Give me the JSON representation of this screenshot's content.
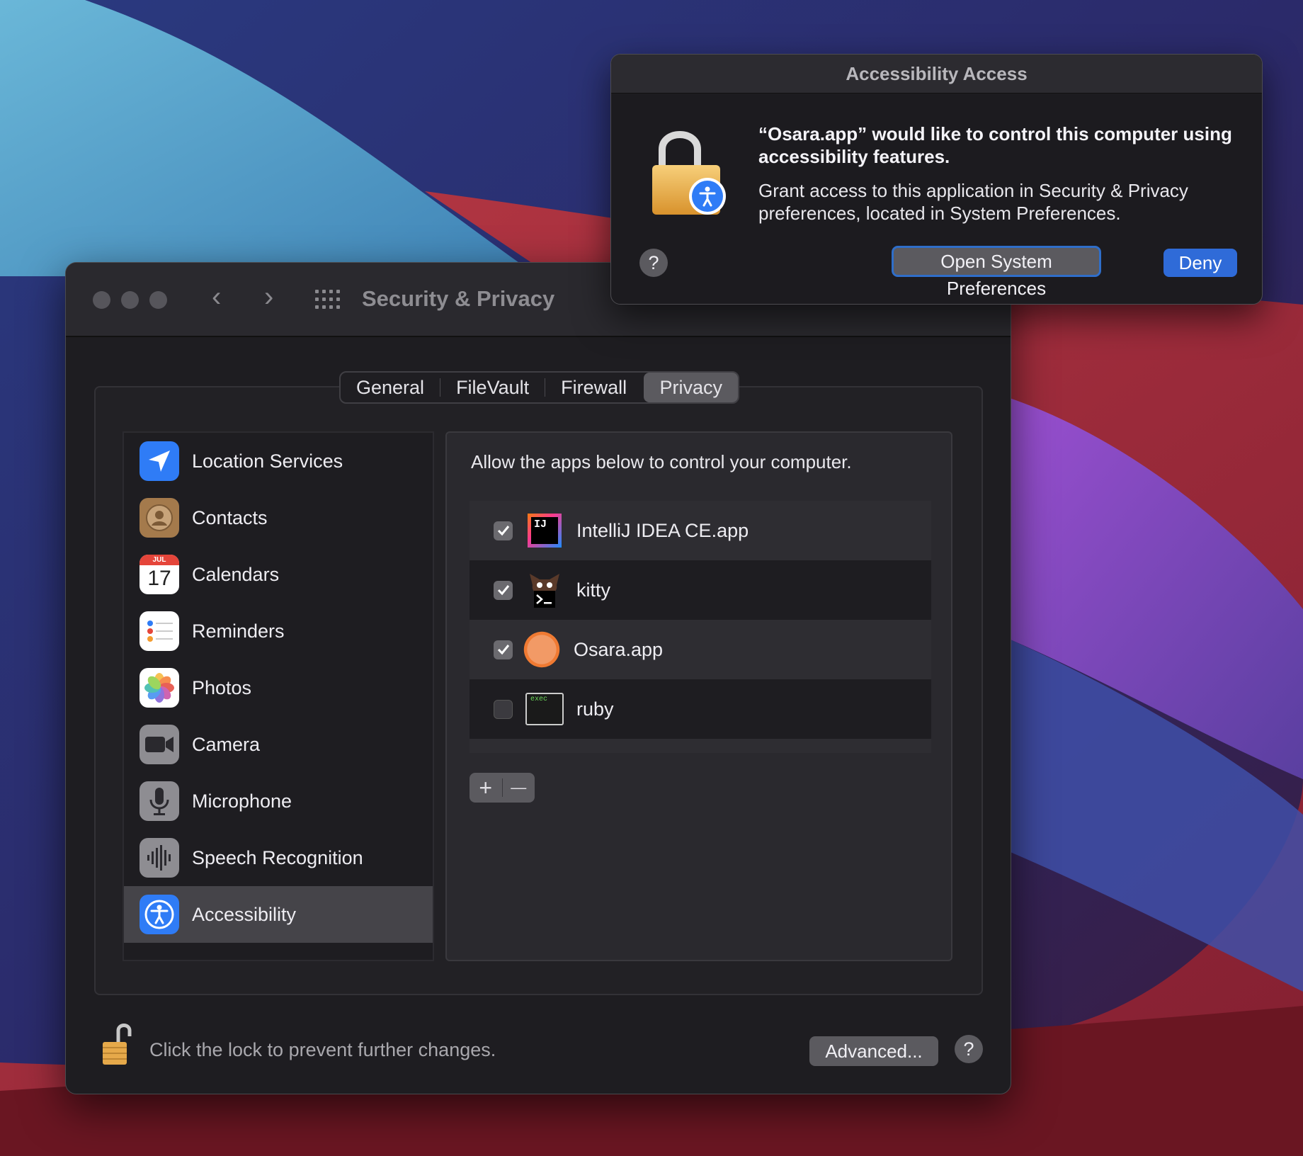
{
  "dialog": {
    "title": "Accessibility Access",
    "headline": "“Osara.app” would like to control this computer using accessibility features.",
    "body": "Grant access to this application in Security & Privacy preferences, located in System Preferences.",
    "open_button": "Open System Preferences",
    "deny_button": "Deny",
    "help": "?"
  },
  "window": {
    "title": "Security & Privacy",
    "back": "‹",
    "forward": "›"
  },
  "tabs": [
    {
      "label": "General"
    },
    {
      "label": "FileVault"
    },
    {
      "label": "Firewall"
    },
    {
      "label": "Privacy",
      "selected": true
    }
  ],
  "sidebar": {
    "items": [
      {
        "label": "Location Services",
        "icon": "location-icon"
      },
      {
        "label": "Contacts",
        "icon": "contacts-icon"
      },
      {
        "label": "Calendars",
        "icon": "calendar-icon",
        "month": "JUL",
        "day": "17"
      },
      {
        "label": "Reminders",
        "icon": "reminders-icon"
      },
      {
        "label": "Photos",
        "icon": "photos-icon"
      },
      {
        "label": "Camera",
        "icon": "camera-icon"
      },
      {
        "label": "Microphone",
        "icon": "microphone-icon"
      },
      {
        "label": "Speech Recognition",
        "icon": "speech-icon"
      },
      {
        "label": "Accessibility",
        "icon": "accessibility-icon",
        "selected": true
      }
    ]
  },
  "panel": {
    "title": "Allow the apps below to control your computer.",
    "apps": [
      {
        "name": "IntelliJ IDEA CE.app",
        "checked": true,
        "icon": "intellij-icon",
        "icon_text": "IJ"
      },
      {
        "name": "kitty",
        "checked": true,
        "icon": "kitty-icon"
      },
      {
        "name": "Osara.app",
        "checked": true,
        "icon": "osara-icon"
      },
      {
        "name": "ruby",
        "checked": false,
        "icon": "terminal-exec-icon",
        "icon_text": "exec"
      }
    ],
    "add": "+",
    "remove": "—"
  },
  "footer": {
    "lock_text": "Click the lock to prevent further changes.",
    "advanced": "Advanced...",
    "help": "?"
  },
  "colors": {
    "accent": "#2f6bd8",
    "window_bg": "#1e1d21",
    "selected_row": "#454449"
  }
}
